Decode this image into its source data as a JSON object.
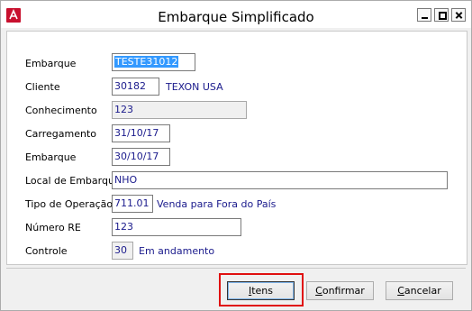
{
  "window": {
    "title": "Embarque Simplificado",
    "controls": [
      "minimize-icon",
      "maximize-icon",
      "close-icon"
    ]
  },
  "form": {
    "embarque_code": {
      "label": "Embarque",
      "value": "TESTE31012"
    },
    "cliente": {
      "label": "Cliente",
      "value": "30182",
      "description": "TEXON USA"
    },
    "conhecimento": {
      "label": "Conhecimento",
      "value": "123"
    },
    "carregamento": {
      "label": "Carregamento",
      "value": "31/10/17"
    },
    "embarque_date": {
      "label": "Embarque",
      "value": "30/10/17"
    },
    "local_embarque": {
      "label": "Local de Embarque",
      "value": "NHO"
    },
    "tipo_operacao": {
      "label": "Tipo de Operação",
      "value": "711.01",
      "description": "Venda para Fora do País"
    },
    "numero_re": {
      "label": "Número RE",
      "value": "123"
    },
    "controle": {
      "label": "Controle",
      "value": "30",
      "description": "Em andamento"
    }
  },
  "buttons": {
    "itens": {
      "accel": "I",
      "rest": "tens"
    },
    "confirmar": {
      "accel": "C",
      "rest": "onfirmar"
    },
    "cancelar": {
      "accel": "C",
      "rest": "ancelar"
    }
  },
  "colors": {
    "value_text": "#1a1a8c",
    "selection": "#3399ff",
    "highlight": "#e01010",
    "app_icon": "#c8102e"
  }
}
